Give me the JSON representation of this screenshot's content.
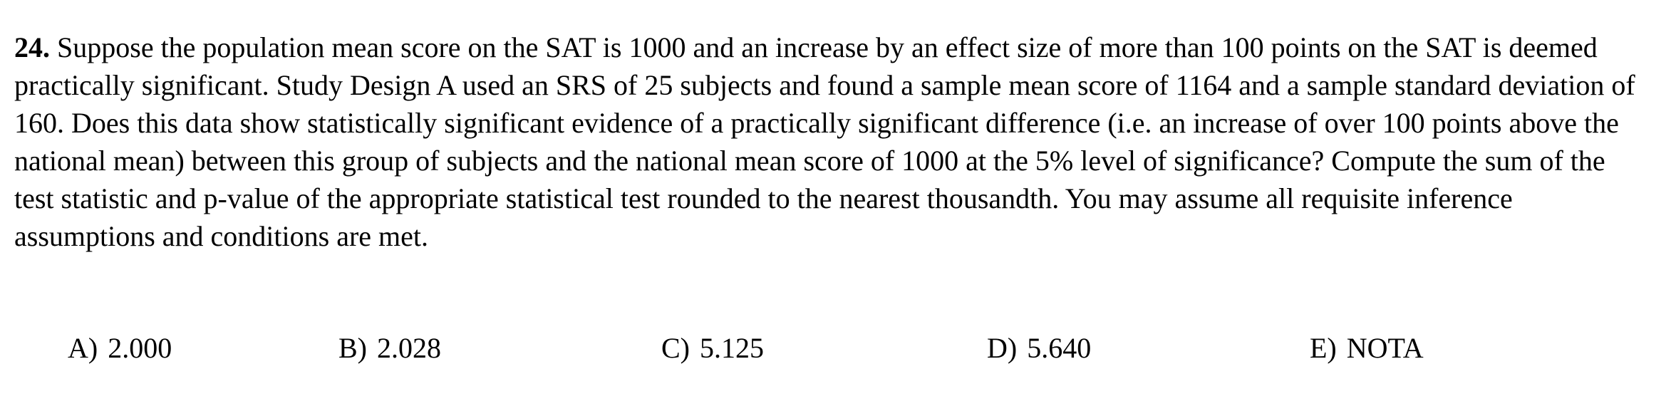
{
  "question": {
    "number": "24.",
    "text": "Suppose the population mean score on the SAT is 1000 and an increase by an effect size of more than 100 points on the SAT is deemed practically significant.  Study Design A used an SRS of 25 subjects and found a sample mean score of 1164 and a sample standard deviation of 160.  Does this data show statistically significant evidence of a practically significant difference (i.e. an increase of over 100 points above the national mean) between this group of subjects and the national mean score of 1000 at the 5% level of significance?  Compute the sum of the test statistic and p-value of the appropriate statistical test rounded to the nearest thousandth.  You may assume all requisite inference assumptions and conditions are met."
  },
  "choices": [
    {
      "letter": "A)",
      "value": "2.000"
    },
    {
      "letter": "B)",
      "value": "2.028"
    },
    {
      "letter": "C)",
      "value": "5.125"
    },
    {
      "letter": "D)",
      "value": "5.640"
    },
    {
      "letter": "E)",
      "value": "NOTA"
    }
  ]
}
